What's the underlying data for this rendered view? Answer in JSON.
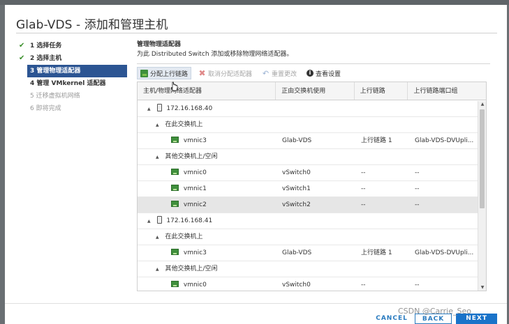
{
  "dialog": {
    "title": "Glab-VDS - 添加和管理主机"
  },
  "steps": [
    {
      "label": "1 选择任务",
      "state": "done"
    },
    {
      "label": "2 选择主机",
      "state": "done"
    },
    {
      "label": "3 管理物理适配器",
      "state": "active"
    },
    {
      "label": "4 管理 VMkernel 适配器",
      "state": "pending"
    },
    {
      "label": "5 迁移虚拟机网络",
      "state": "disabled"
    },
    {
      "label": "6 即将完成",
      "state": "disabled"
    }
  ],
  "main": {
    "title": "管理物理适配器",
    "description": "为此 Distributed Switch 添加或移除物理网络适配器。"
  },
  "toolbar": {
    "assign_uplink": "分配上行链路",
    "unassign_adapter": "取消分配适配器",
    "reset_changes": "重置更改",
    "view_settings": "查看设置"
  },
  "table": {
    "columns": [
      "主机/物理网络适配器",
      "正由交换机使用",
      "上行链路",
      "上行链路端口组"
    ],
    "rows": [
      {
        "kind": "host",
        "name": "172.16.168.40",
        "switch": "",
        "uplink": "",
        "portgroup": ""
      },
      {
        "kind": "group",
        "name": "在此交换机上",
        "switch": "",
        "uplink": "",
        "portgroup": ""
      },
      {
        "kind": "nic",
        "name": "vmnic3",
        "switch": "Glab-VDS",
        "uplink": "上行链路 1",
        "portgroup": "Glab-VDS-DVUpli..."
      },
      {
        "kind": "group",
        "name": "其他交换机上/空闲",
        "switch": "",
        "uplink": "",
        "portgroup": ""
      },
      {
        "kind": "nic",
        "name": "vmnic0",
        "switch": "vSwitch0",
        "uplink": "--",
        "portgroup": "--"
      },
      {
        "kind": "nic",
        "name": "vmnic1",
        "switch": "vSwitch1",
        "uplink": "--",
        "portgroup": "--"
      },
      {
        "kind": "nic",
        "name": "vmnic2",
        "switch": "vSwitch2",
        "uplink": "--",
        "portgroup": "--",
        "selected": true
      },
      {
        "kind": "host",
        "name": "172.16.168.41",
        "switch": "",
        "uplink": "",
        "portgroup": ""
      },
      {
        "kind": "group",
        "name": "在此交换机上",
        "switch": "",
        "uplink": "",
        "portgroup": ""
      },
      {
        "kind": "nic",
        "name": "vmnic3",
        "switch": "Glab-VDS",
        "uplink": "上行链路 1",
        "portgroup": "Glab-VDS-DVUpli..."
      },
      {
        "kind": "group",
        "name": "其他交换机上/空闲",
        "switch": "",
        "uplink": "",
        "portgroup": ""
      },
      {
        "kind": "nic",
        "name": "vmnic0",
        "switch": "vSwitch0",
        "uplink": "--",
        "portgroup": "--"
      }
    ]
  },
  "footer": {
    "cancel": "CANCEL",
    "back": "BACK",
    "next": "NEXT"
  },
  "watermark": "CSDN @Carrie_Seo",
  "colors": {
    "active_step": "#2c5593",
    "primary_button": "#1a73c9",
    "nic_icon": "#3f8f3c"
  }
}
